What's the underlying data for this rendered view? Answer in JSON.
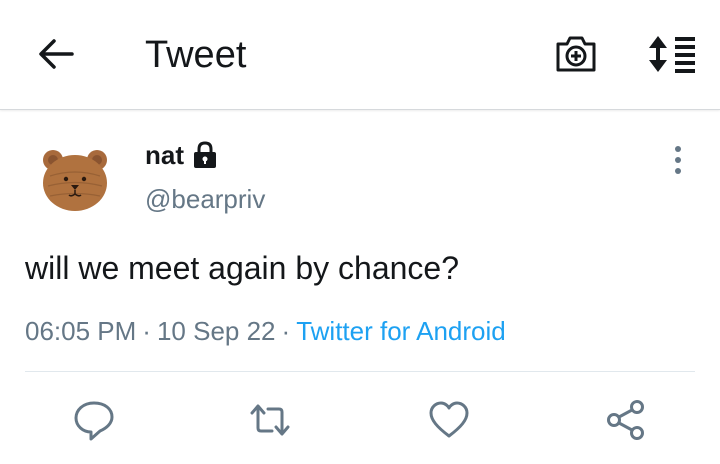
{
  "header": {
    "title": "Tweet"
  },
  "icons": {
    "back": "back-arrow-icon",
    "camera": "camera-plus-icon",
    "sort": "sort-list-icon",
    "lock": "lock-icon",
    "more": "more-vertical-icon",
    "reply": "reply-icon",
    "retweet": "retweet-icon",
    "like": "heart-icon",
    "share": "share-icon"
  },
  "tweet": {
    "name": "nat",
    "handle": "@bearpriv",
    "text": "will we meet again by chance?",
    "time": "06:05 PM",
    "date": "10 Sep 22",
    "separator": "·",
    "source": "Twitter for Android"
  },
  "colors": {
    "accent": "#1da1f2",
    "secondary_text": "#657786",
    "icon_gray": "#657786"
  }
}
